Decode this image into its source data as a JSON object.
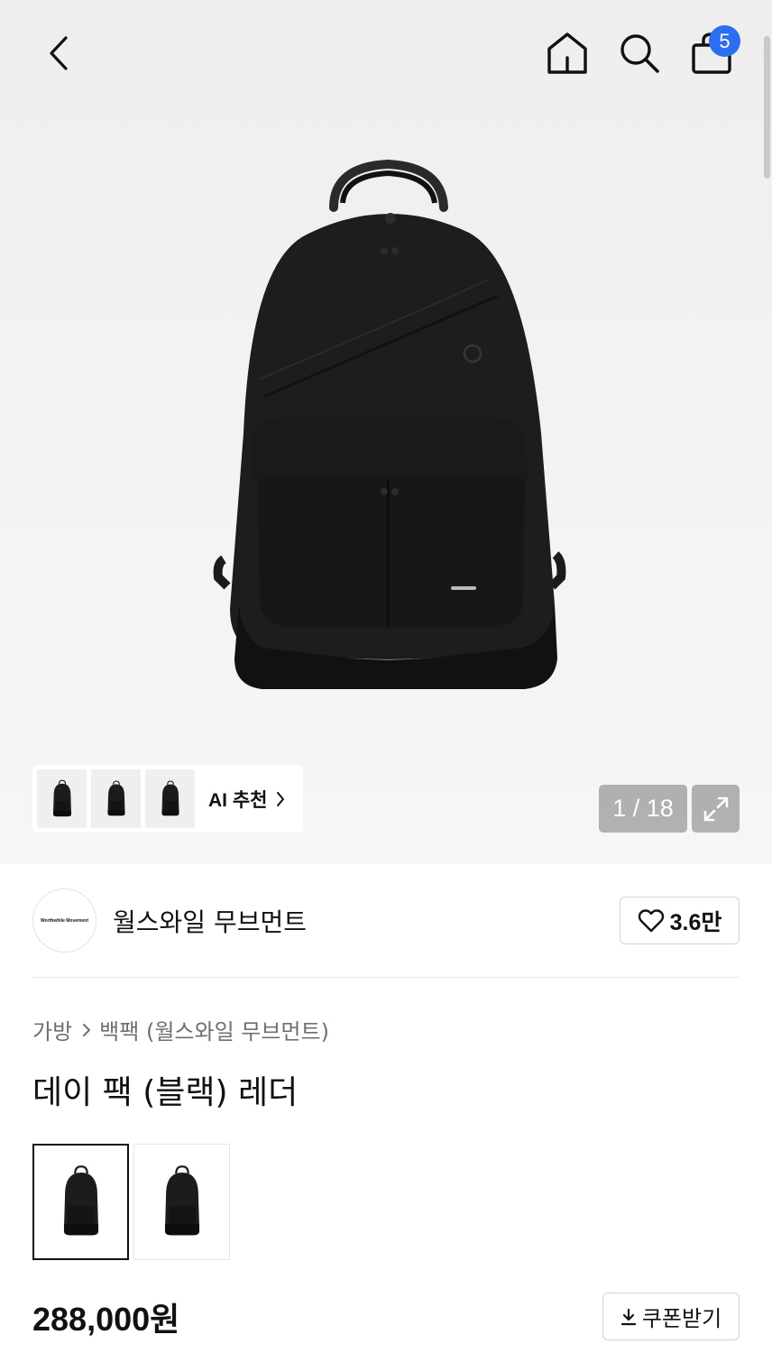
{
  "topbar": {
    "back_icon": "chevron-left-icon",
    "home_icon": "home-icon",
    "search_icon": "search-icon",
    "bag_icon": "shopping-bag-icon",
    "cart_count": "5",
    "badge_color": "#2b6ef2"
  },
  "gallery": {
    "ai_label": "AI 추천",
    "counter": "1 / 18",
    "expand_icon": "expand-icon"
  },
  "brand": {
    "logo_text": "Worthwhile Movement",
    "name": "월스와일 무브먼트",
    "like_count": "3.6만",
    "heart_icon": "heart-icon"
  },
  "breadcrumb": {
    "category": "가방",
    "subcategory": "백팩 (월스와일 무브먼트)"
  },
  "product": {
    "title": "데이 팩 (블랙) 레더",
    "price": "288,000원"
  },
  "coupon": {
    "label": "쿠폰받기",
    "icon": "download-icon"
  }
}
